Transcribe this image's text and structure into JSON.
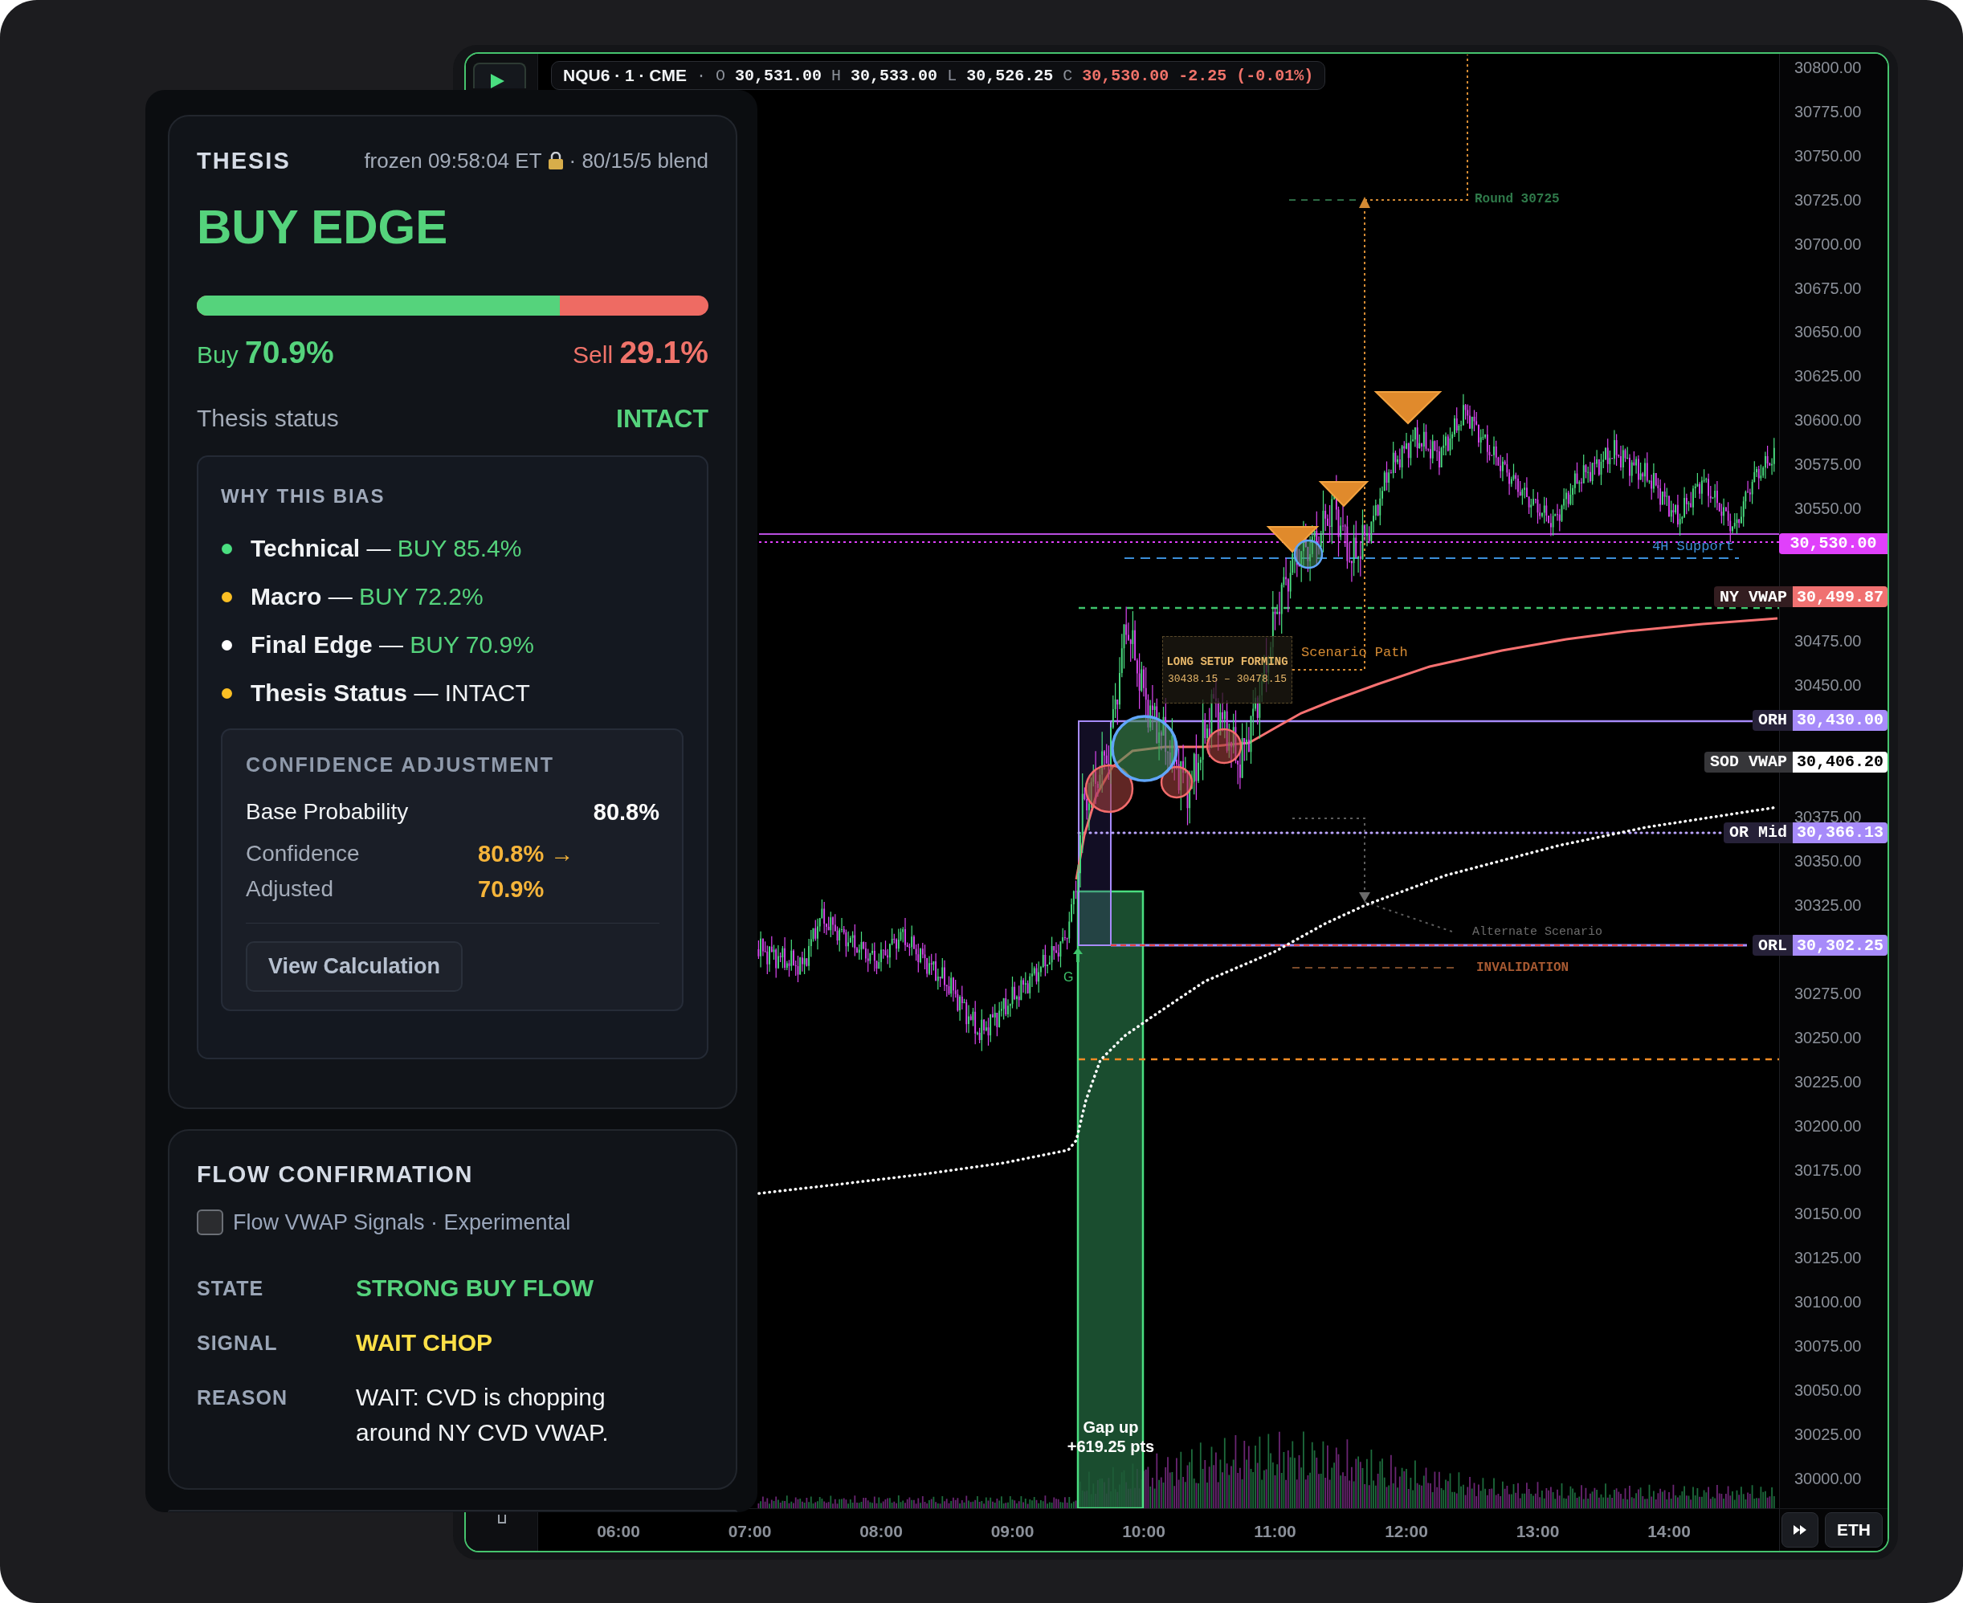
{
  "thesis": {
    "title": "THESIS",
    "frozen": "frozen 09:58:04 ET",
    "blend": "· 80/15/5 blend",
    "bias": "BUY EDGE",
    "level": 0.709,
    "buy": {
      "label": "Buy",
      "value": "70.9%"
    },
    "sell": {
      "label": "Sell",
      "value": "29.1%"
    },
    "status": {
      "label": "Thesis status",
      "value": "INTACT"
    },
    "why_this_bias": {
      "title": "WHY THIS BIAS",
      "items": [
        {
          "kind": "buy",
          "name": "Technical",
          "separator": "—",
          "value": "BUY 85.4%",
          "color": "#4ade80"
        },
        {
          "kind": "buy",
          "name": "Macro",
          "separator": "—",
          "value": "BUY 72.2%",
          "color": "#fbbf24"
        },
        {
          "kind": "buy",
          "name": "Final Edge",
          "separator": "—",
          "value": "BUY 70.9%",
          "color": "#ffffff"
        },
        {
          "kind": "plain",
          "name": "Thesis Status",
          "separator": "—",
          "value": "INTACT",
          "color": "#fbbf24"
        }
      ],
      "confidence_adjustment": {
        "title": "CONFIDENCE ADJUSTMENT",
        "rows": [
          {
            "kind": "base",
            "label": "Base Probability",
            "value": "80.8%"
          },
          {
            "kind": "adjusted",
            "label": "Confidence Adjusted",
            "value": "80.8% → 70.9%"
          }
        ],
        "button": "View Calculation"
      }
    }
  },
  "flow_confirmation": {
    "title": "FLOW CONFIRMATION",
    "toggle": {
      "label": "Flow VWAP Signals · Experimental",
      "checked": false
    },
    "rows": [
      {
        "kind": "buy",
        "label": "STATE",
        "value": "STRONG BUY FLOW"
      },
      {
        "kind": "wait",
        "label": "SIGNAL",
        "value": "WAIT CHOP"
      },
      {
        "kind": "plain",
        "label": "REASON",
        "value": "WAIT: CVD is chopping around NY CVD VWAP."
      }
    ]
  },
  "chart": {
    "legend": {
      "symbol": "NQU6 · 1 · CME",
      "separator": "·",
      "fields": [
        {
          "kind": "plain",
          "key": "O",
          "value": "30,531.00"
        },
        {
          "kind": "plain",
          "key": "H",
          "value": "30,533.00"
        },
        {
          "kind": "plain",
          "key": "L",
          "value": "30,526.25"
        },
        {
          "kind": "down",
          "key": "C",
          "value": "30,530.00"
        },
        {
          "kind": "down",
          "value": "-2.25 (-0.01%)"
        }
      ]
    },
    "price_axis": [
      "30800.00",
      "30775.00",
      "30750.00",
      "30725.00",
      "30700.00",
      "30675.00",
      "30650.00",
      "30625.00",
      "30600.00",
      "30575.00",
      "30550.00",
      "30475.00",
      "30450.00",
      "30375.00",
      "30350.00",
      "30325.00",
      "30275.00",
      "30250.00",
      "30225.00",
      "30200.00",
      "30175.00",
      "30150.00",
      "30125.00",
      "30100.00",
      "30075.00",
      "30050.00",
      "30025.00",
      "30000.00"
    ],
    "levels": [
      {
        "value": "30,530.00",
        "color": "#e040fb"
      },
      {
        "name": "NY VWAP",
        "value": "30,499.87",
        "color": "#f07171"
      },
      {
        "name": "ORH",
        "value": "30,430.00",
        "color": "#a78bfa"
      },
      {
        "name": "SOD VWAP",
        "value": "30,406.20",
        "color": "#ffffff"
      },
      {
        "name": "OR Mid",
        "value": "30,366.13",
        "color": "#a78bfa"
      },
      {
        "name": "ORL",
        "value": "30,302.25",
        "color": "#a78bfa"
      }
    ],
    "annotations": [
      {
        "kind": "round",
        "text": "Round 30725"
      },
      {
        "kind": "support",
        "text": "4H Support"
      },
      {
        "kind": "setup",
        "text": "LONG SETUP FORMING",
        "detail": "30438.15 – 30478.15"
      },
      {
        "kind": "scenario",
        "text": "Scenario Path"
      },
      {
        "kind": "alternate",
        "text": "Alternate Scenario"
      },
      {
        "kind": "invalidation",
        "text": "INVALIDATION"
      },
      {
        "kind": "marker",
        "text": "G"
      },
      {
        "kind": "gap",
        "text": "Gap up",
        "detail": "+619.25 pts"
      }
    ],
    "time_axis": [
      "06:00",
      "07:00",
      "08:00",
      "09:00",
      "10:00",
      "11:00",
      "12:00",
      "13:00",
      "14:00"
    ],
    "session_button": "ETH"
  }
}
